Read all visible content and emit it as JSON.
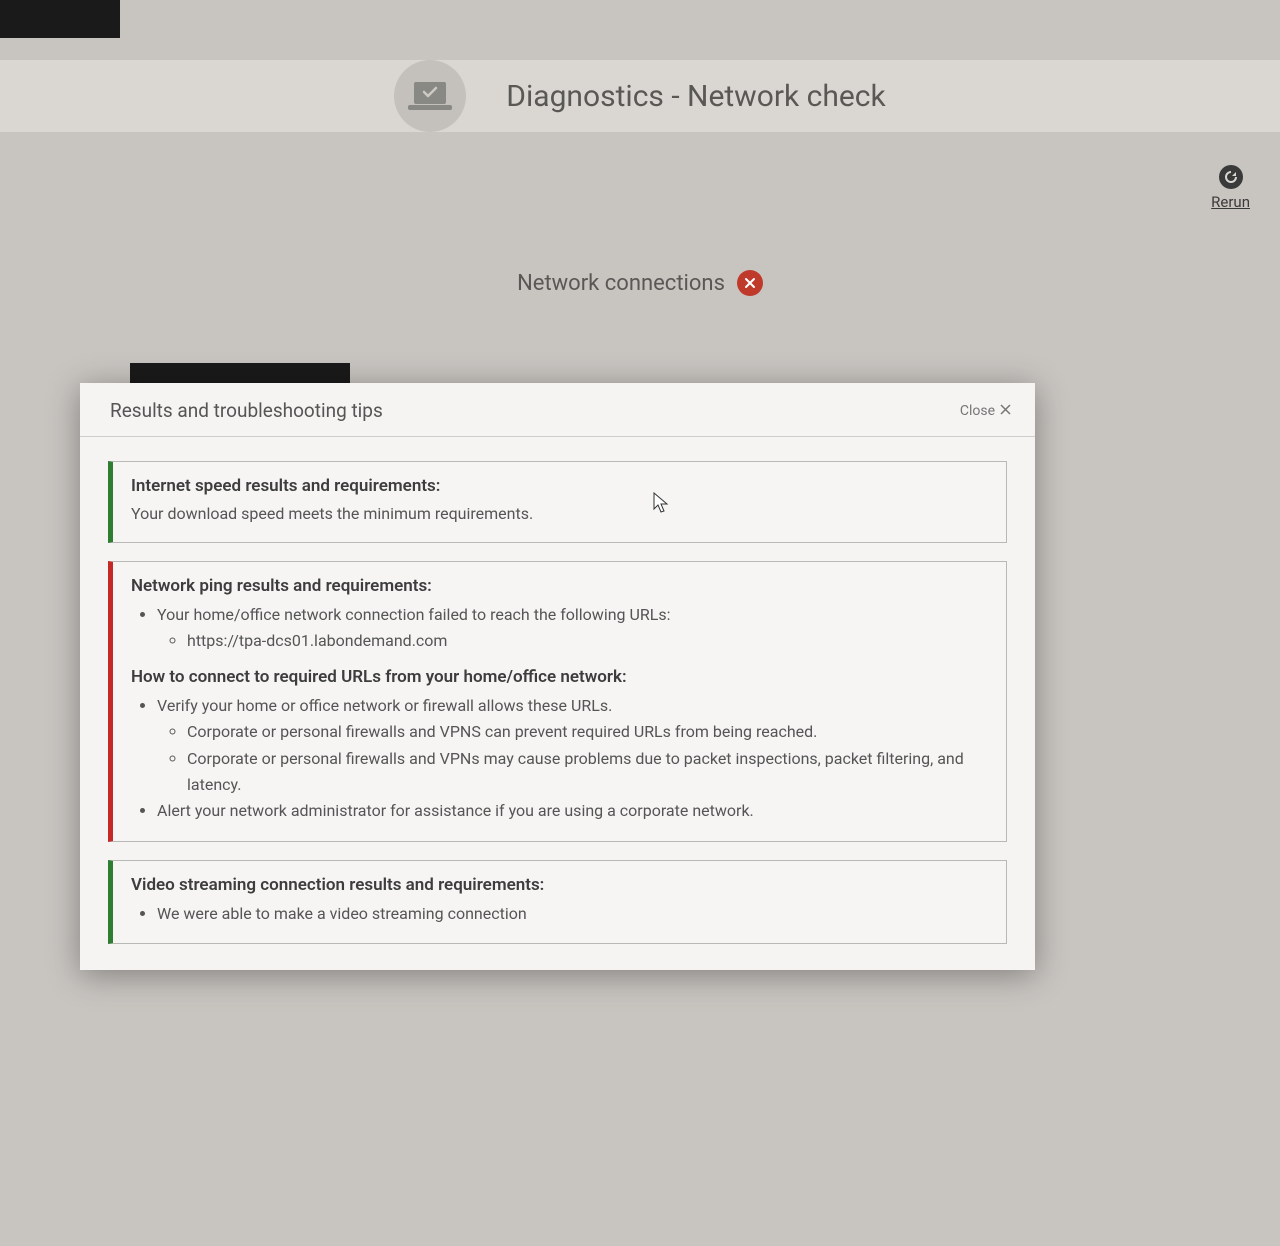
{
  "header": {
    "title": "Diagnostics - Network check"
  },
  "rerun": {
    "label": "Rerun"
  },
  "section": {
    "title": "Network connections"
  },
  "modal": {
    "title": "Results and troubleshooting tips",
    "close_label": "Close"
  },
  "results": {
    "speed": {
      "heading": "Internet speed results and requirements:",
      "text": "Your download speed meets the minimum requirements."
    },
    "ping": {
      "heading": "Network ping results and requirements:",
      "fail_intro": "Your home/office network connection failed to reach the following URLs:",
      "failed_urls": [
        "https://tpa-dcs01.labondemand.com"
      ],
      "howto_heading": "How to connect to required URLs from your home/office network:",
      "tips": {
        "verify": "Verify your home or office network or firewall allows these URLs.",
        "verify_sub1": "Corporate or personal firewalls and VPNS can prevent required URLs from being reached.",
        "verify_sub2": "Corporate or personal firewalls and VPNs may cause problems due to packet inspections, packet filtering, and latency.",
        "alert_admin": "Alert your network administrator for assistance if you are using a corporate network."
      }
    },
    "video": {
      "heading": "Video streaming connection results and requirements:",
      "text": "We were able to make a video streaming connection"
    }
  }
}
